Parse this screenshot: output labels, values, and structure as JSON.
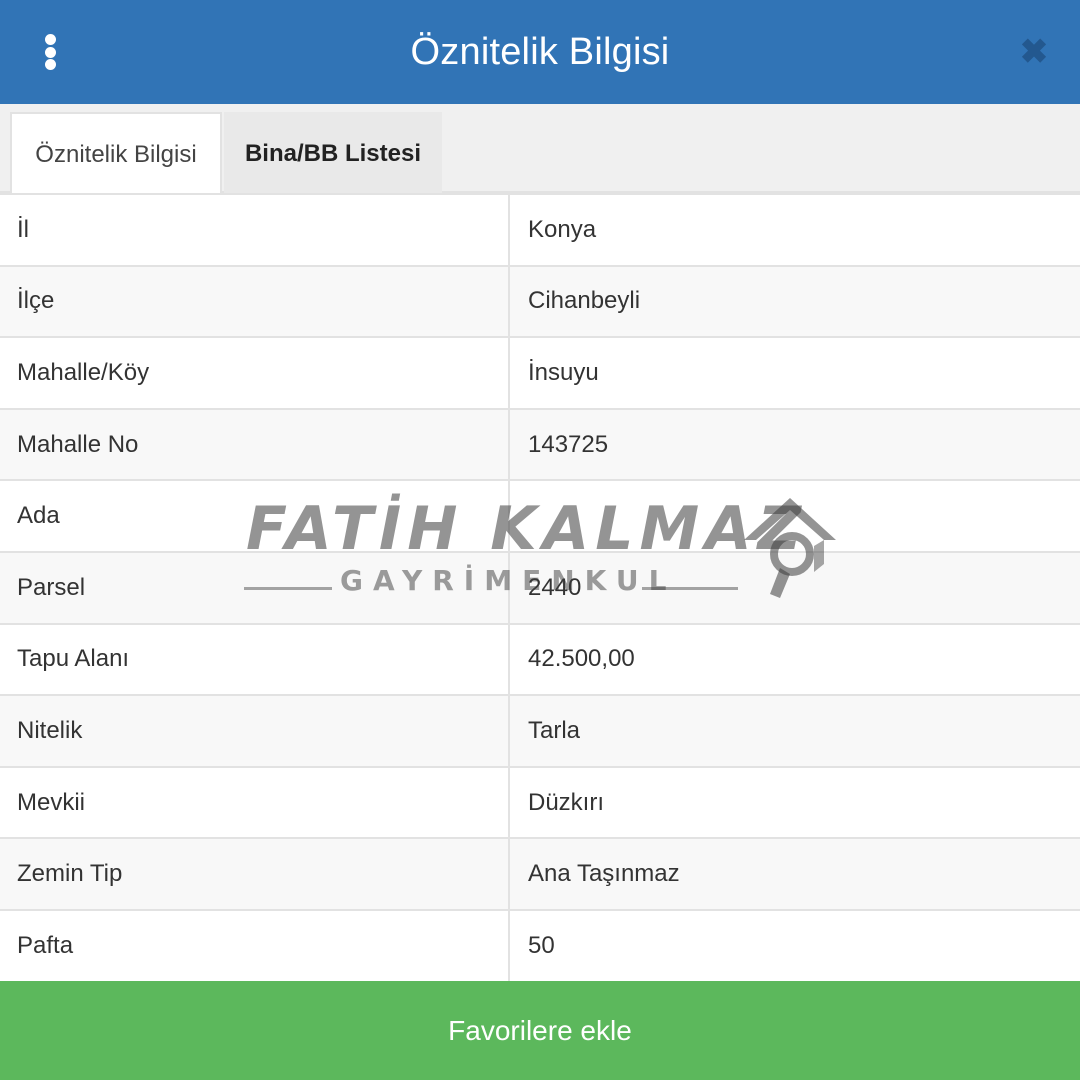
{
  "header": {
    "title": "Öznitelik Bilgisi",
    "menu_icon": "vertical-ellipsis-icon",
    "close_icon": "close-icon",
    "color": "#3174b6"
  },
  "tabs": [
    {
      "label": "Öznitelik Bilgisi",
      "active": true
    },
    {
      "label": "Bina/BB Listesi",
      "active": false
    }
  ],
  "rows": [
    {
      "label": "İl",
      "value": "Konya"
    },
    {
      "label": "İlçe",
      "value": "Cihanbeyli"
    },
    {
      "label": "Mahalle/Köy",
      "value": "İnsuyu"
    },
    {
      "label": "Mahalle No",
      "value": "143725"
    },
    {
      "label": "Ada",
      "value": ""
    },
    {
      "label": "Parsel",
      "value": "2440"
    },
    {
      "label": "Tapu Alanı",
      "value": "42.500,00"
    },
    {
      "label": "Nitelik",
      "value": "Tarla"
    },
    {
      "label": "Mevkii",
      "value": "Düzkırı"
    },
    {
      "label": "Zemin Tip",
      "value": "Ana Taşınmaz"
    },
    {
      "label": "Pafta",
      "value": "50"
    }
  ],
  "favorite_button": {
    "label": "Favorilere ekle",
    "color": "#5cb85c"
  },
  "watermark": {
    "name": "FATİH KALMAZ",
    "subtitle": "GAYRİMENKUL",
    "icon": "house-search-icon"
  }
}
